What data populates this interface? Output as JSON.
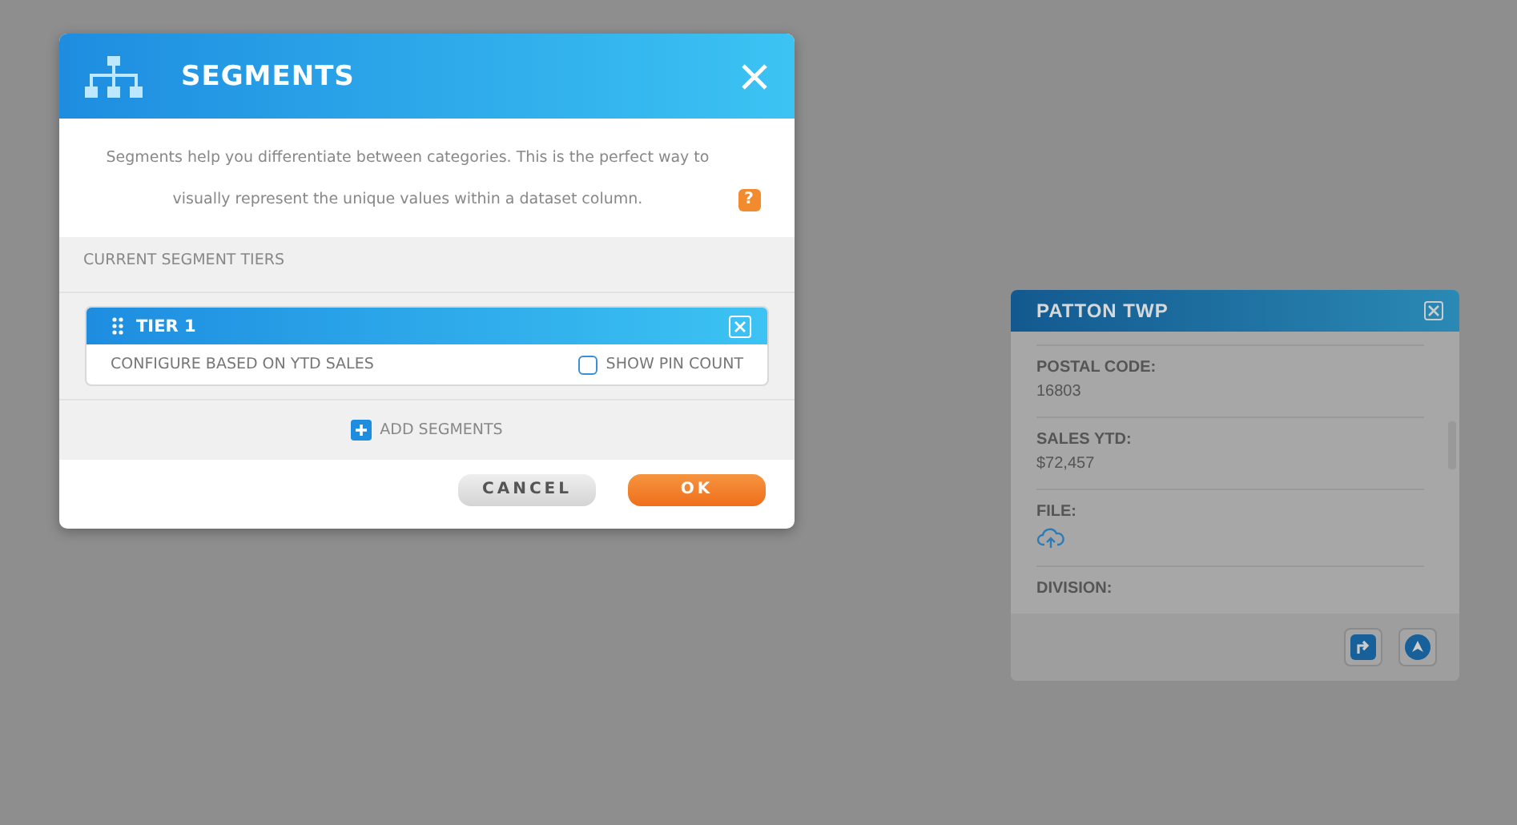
{
  "modal": {
    "title": "SEGMENTS",
    "description": "Segments help you differentiate between categories. This is the perfect way to visually represent the unique values within a dataset column.",
    "help": "?",
    "section_title": "CURRENT SEGMENT TIERS",
    "tiers": [
      {
        "name": "TIER 1",
        "configuration": "CONFIGURE BASED ON YTD SALES",
        "show_pin_count": {
          "label": "SHOW PIN COUNT",
          "checked": false
        }
      }
    ],
    "add_button": "ADD SEGMENTS",
    "buttons": [
      {
        "label": "CANCEL",
        "kind": "secondary"
      },
      {
        "label": "OK",
        "kind": "primary"
      }
    ]
  },
  "popup": {
    "title": "PATTON TWP",
    "fields": [
      {
        "label": "POSTAL CODE:",
        "kind": "text",
        "value": "16803"
      },
      {
        "label": "SALES YTD:",
        "kind": "text",
        "value": "$72,457"
      },
      {
        "label": "FILE:",
        "kind": "file"
      },
      {
        "label": "DIVISION:",
        "kind": "text"
      }
    ]
  }
}
